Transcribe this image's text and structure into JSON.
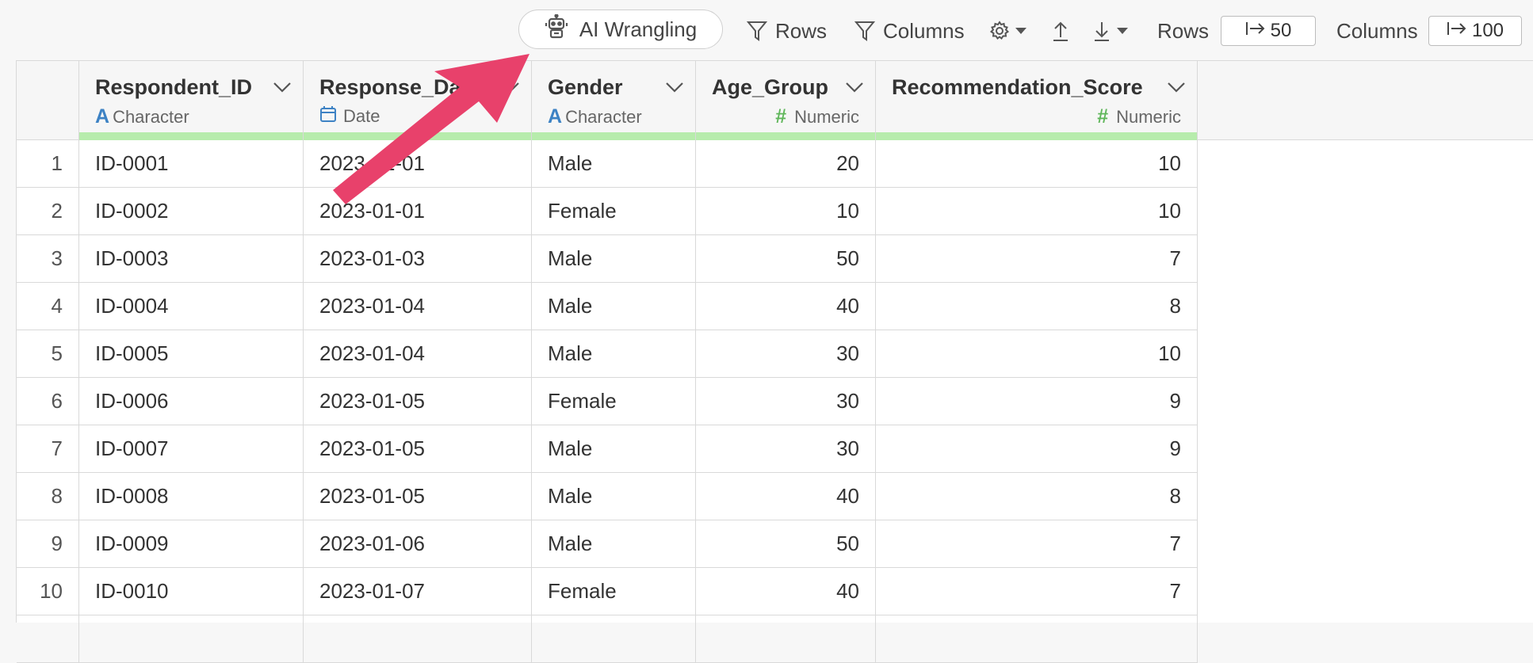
{
  "toolbar": {
    "ai_wrangling_label": "AI Wrangling",
    "rows_filter_label": "Rows",
    "columns_filter_label": "Columns",
    "rows_limit_label": "Rows",
    "rows_limit_value": "50",
    "columns_limit_label": "Columns",
    "columns_limit_value": "100"
  },
  "colors": {
    "accent_arrow": "#e8416b",
    "quality_bar": "#b7ecac",
    "char_icon": "#3d82c4",
    "numeric_icon": "#5fb65a"
  },
  "columns": [
    {
      "name": "Respondent_ID",
      "type": "Character",
      "type_icon": "A"
    },
    {
      "name": "Response_Date",
      "type": "Date",
      "type_icon": "calendar-icon"
    },
    {
      "name": "Gender",
      "type": "Character",
      "type_icon": "A"
    },
    {
      "name": "Age_Group",
      "type": "Numeric",
      "type_icon": "#"
    },
    {
      "name": "Recommendation_Score",
      "type": "Numeric",
      "type_icon": "#"
    }
  ],
  "rows": [
    {
      "n": "1",
      "id": "ID-0001",
      "date": "2023-01-01",
      "gender": "Male",
      "age": "20",
      "score": "10"
    },
    {
      "n": "2",
      "id": "ID-0002",
      "date": "2023-01-01",
      "gender": "Female",
      "age": "10",
      "score": "10"
    },
    {
      "n": "3",
      "id": "ID-0003",
      "date": "2023-01-03",
      "gender": "Male",
      "age": "50",
      "score": "7"
    },
    {
      "n": "4",
      "id": "ID-0004",
      "date": "2023-01-04",
      "gender": "Male",
      "age": "40",
      "score": "8"
    },
    {
      "n": "5",
      "id": "ID-0005",
      "date": "2023-01-04",
      "gender": "Male",
      "age": "30",
      "score": "10"
    },
    {
      "n": "6",
      "id": "ID-0006",
      "date": "2023-01-05",
      "gender": "Female",
      "age": "30",
      "score": "9"
    },
    {
      "n": "7",
      "id": "ID-0007",
      "date": "2023-01-05",
      "gender": "Male",
      "age": "30",
      "score": "9"
    },
    {
      "n": "8",
      "id": "ID-0008",
      "date": "2023-01-05",
      "gender": "Male",
      "age": "40",
      "score": "8"
    },
    {
      "n": "9",
      "id": "ID-0009",
      "date": "2023-01-06",
      "gender": "Male",
      "age": "50",
      "score": "7"
    },
    {
      "n": "10",
      "id": "ID-0010",
      "date": "2023-01-07",
      "gender": "Female",
      "age": "40",
      "score": "7"
    }
  ]
}
